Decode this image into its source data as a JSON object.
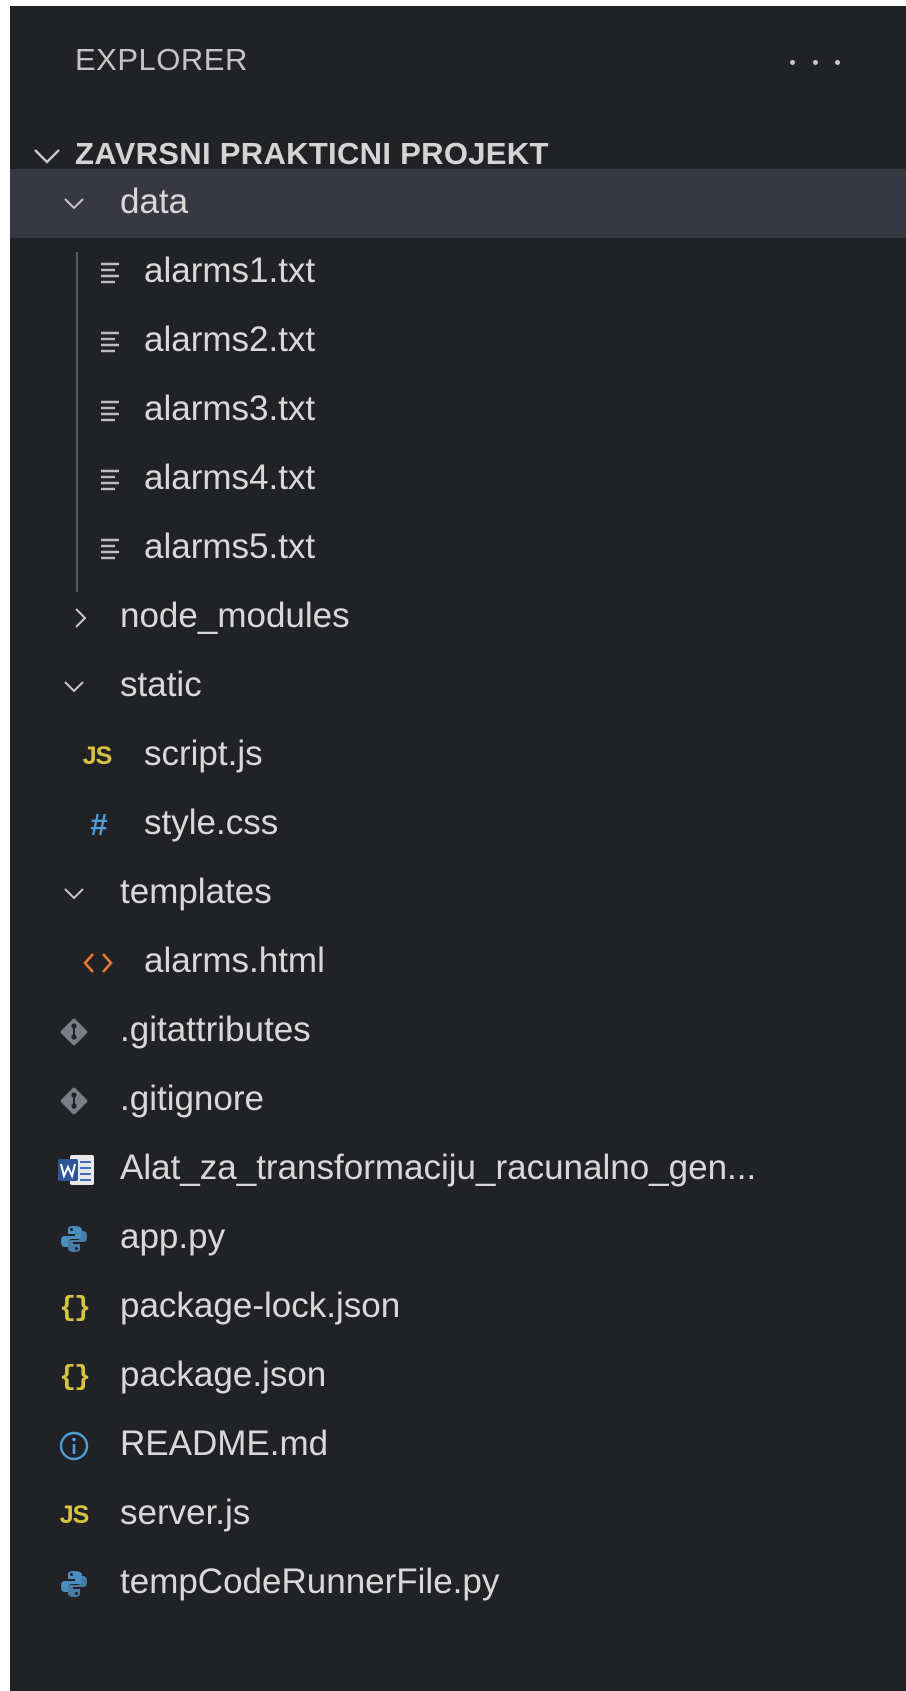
{
  "panel": {
    "title": "EXPLORER",
    "more_actions_icon": "ellipsis-icon"
  },
  "project": {
    "name": "ZAVRSNI PRAKTICNI PROJEKT",
    "expanded": true
  },
  "tree": [
    {
      "label": "data",
      "kind": "folder",
      "expanded": true,
      "selected": true
    },
    {
      "label": "alarms1.txt",
      "kind": "file",
      "icon": "text-file-icon"
    },
    {
      "label": "alarms2.txt",
      "kind": "file",
      "icon": "text-file-icon"
    },
    {
      "label": "alarms3.txt",
      "kind": "file",
      "icon": "text-file-icon"
    },
    {
      "label": "alarms4.txt",
      "kind": "file",
      "icon": "text-file-icon"
    },
    {
      "label": "alarms5.txt",
      "kind": "file",
      "icon": "text-file-icon"
    },
    {
      "label": "node_modules",
      "kind": "folder",
      "expanded": false
    },
    {
      "label": "static",
      "kind": "folder",
      "expanded": true
    },
    {
      "label": "script.js",
      "kind": "file",
      "icon": "javascript-icon",
      "icon_text": "JS"
    },
    {
      "label": "style.css",
      "kind": "file",
      "icon": "css-icon",
      "icon_text": "#"
    },
    {
      "label": "templates",
      "kind": "folder",
      "expanded": true
    },
    {
      "label": "alarms.html",
      "kind": "file",
      "icon": "html-icon"
    },
    {
      "label": ".gitattributes",
      "kind": "file",
      "icon": "git-icon"
    },
    {
      "label": ".gitignore",
      "kind": "file",
      "icon": "git-icon"
    },
    {
      "label": "Alat_za_transformaciju_racunalno_gen...",
      "kind": "file",
      "icon": "word-document-icon"
    },
    {
      "label": "app.py",
      "kind": "file",
      "icon": "python-icon"
    },
    {
      "label": "package-lock.json",
      "kind": "file",
      "icon": "json-icon",
      "icon_text": "{}"
    },
    {
      "label": "package.json",
      "kind": "file",
      "icon": "json-icon",
      "icon_text": "{}"
    },
    {
      "label": "README.md",
      "kind": "file",
      "icon": "info-icon"
    },
    {
      "label": "server.js",
      "kind": "file",
      "icon": "javascript-icon",
      "icon_text": "JS"
    },
    {
      "label": "tempCodeRunnerFile.py",
      "kind": "file",
      "icon": "python-icon"
    }
  ],
  "colors": {
    "background": "#212226",
    "selected_row": "#373841",
    "javascript": "#d7c33e",
    "css": "#4f9ed6",
    "html": "#e37933",
    "git": "#7b7d85",
    "python": "#4c8ec0",
    "info": "#4f9ed6"
  }
}
